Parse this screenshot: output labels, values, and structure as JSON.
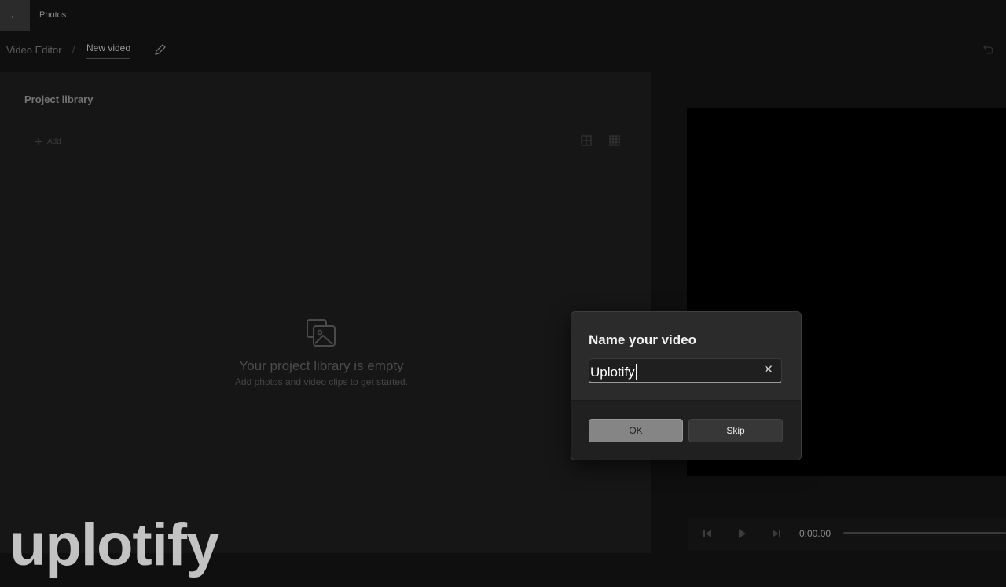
{
  "app": {
    "back_icon": "arrow-left-icon",
    "title": "Photos"
  },
  "breadcrumb": {
    "root": "Video Editor",
    "separator": "/",
    "current": "New video"
  },
  "library": {
    "title": "Project library",
    "add_label": "Add",
    "empty_title": "Your project library is empty",
    "empty_subtitle": "Add photos and video clips to get started."
  },
  "player": {
    "time": "0:00.00"
  },
  "dialog": {
    "title": "Name your video",
    "input_value": "Uplotify",
    "ok_label": "OK",
    "skip_label": "Skip"
  },
  "watermark": {
    "text": "uplotify"
  }
}
